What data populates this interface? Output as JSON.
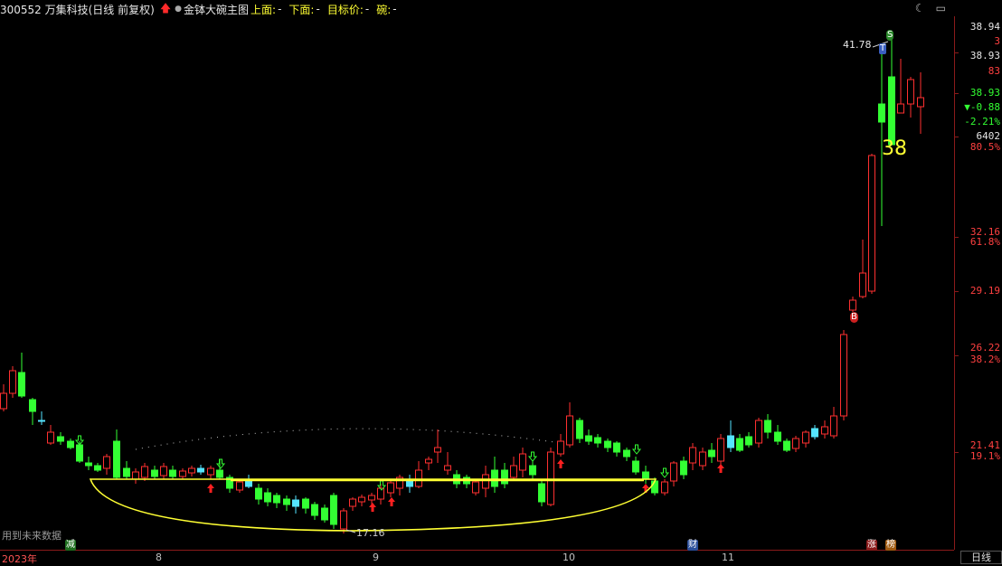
{
  "header": {
    "stock": "300552 万集科技(日线 前复权)",
    "indicator": "金钵大碗主图",
    "upper_label": "上面:",
    "upper_value": "-",
    "lower_label": "下面:",
    "lower_value": "-",
    "target_label": "目标价:",
    "target_value": "-",
    "bowl_label": "碗:",
    "bowl_value": "-"
  },
  "top_icons": [
    "moon-icon",
    "monitor-icon"
  ],
  "right_axis": [
    {
      "text": "38.94",
      "color": "#e6e6e6"
    },
    {
      "text": "3",
      "color": "#ff4040"
    },
    {
      "text": "38.93",
      "color": "#e6e6e6"
    },
    {
      "text": "83",
      "color": "#ff4040"
    },
    {
      "text": "38.93",
      "color": "#33ff33"
    },
    {
      "text": "▼-0.88",
      "color": "#33ff33"
    },
    {
      "text": "-2.21%",
      "color": "#33ff33"
    },
    {
      "text": "6402",
      "color": "#e6e6e6"
    },
    {
      "text": "80.5%",
      "color": "#ff4040"
    },
    {
      "text": "32.16",
      "color": "#ff4040"
    },
    {
      "text": "61.8%",
      "color": "#ff4040"
    },
    {
      "text": "29.19",
      "color": "#ff4040"
    },
    {
      "text": "26.22",
      "color": "#ff4040"
    },
    {
      "text": "38.2%",
      "color": "#ff4040"
    },
    {
      "text": "21.41",
      "color": "#ff4040"
    },
    {
      "text": "19.1%",
      "color": "#ff4040"
    }
  ],
  "x_labels": [
    "2023年",
    "8",
    "9",
    "10",
    "11"
  ],
  "period_label": "日线",
  "no_future": "用到未来数据",
  "annotations": {
    "high": "41.78",
    "low": "17.16",
    "big_number": "38"
  },
  "badges": [
    "S",
    "T",
    "B",
    "减",
    "财",
    "涨",
    "榜"
  ],
  "colors": {
    "up": "#ff3030",
    "down": "#33ff33",
    "doji": "#55e5ff",
    "bowl": "#ffff33"
  }
}
